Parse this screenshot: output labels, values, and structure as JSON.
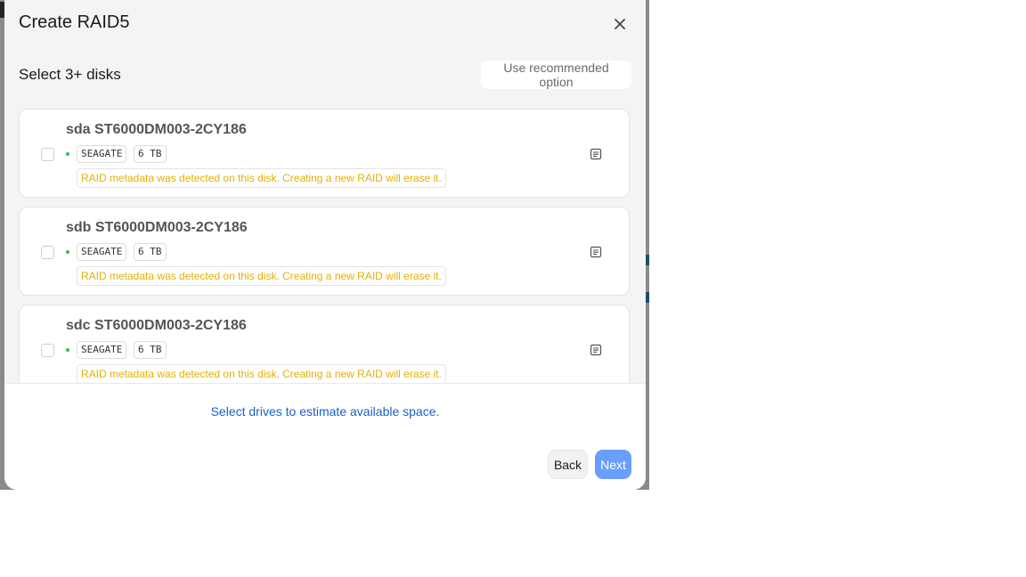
{
  "modal": {
    "title": "Create RAID5",
    "close_icon": "close-icon"
  },
  "selection": {
    "heading": "Select 3+ disks",
    "recommend_label": "Use recommended option"
  },
  "disks": [
    {
      "name": "sda ST6000DM003-2CY186",
      "vendor": "SEAGATE",
      "size": "6 TB",
      "warning": "RAID metadata was detected on this disk. Creating a new RAID will erase it.",
      "status_color": "#2fbf5a",
      "checked": false
    },
    {
      "name": "sdb ST6000DM003-2CY186",
      "vendor": "SEAGATE",
      "size": "6 TB",
      "warning": "RAID metadata was detected on this disk. Creating a new RAID will erase it.",
      "status_color": "#2fbf5a",
      "checked": false
    },
    {
      "name": "sdc ST6000DM003-2CY186",
      "vendor": "SEAGATE",
      "size": "6 TB",
      "warning": "RAID metadata was detected on this disk. Creating a new RAID will erase it.",
      "status_color": "#2fbf5a",
      "checked": false
    }
  ],
  "footer": {
    "estimate_text": "Select drives to estimate available space.",
    "back_label": "Back",
    "next_label": "Next"
  },
  "colors": {
    "accent": "#6a9efb",
    "link": "#1a5fc9",
    "warning": "#e3b007",
    "status_ok": "#2fbf5a"
  }
}
